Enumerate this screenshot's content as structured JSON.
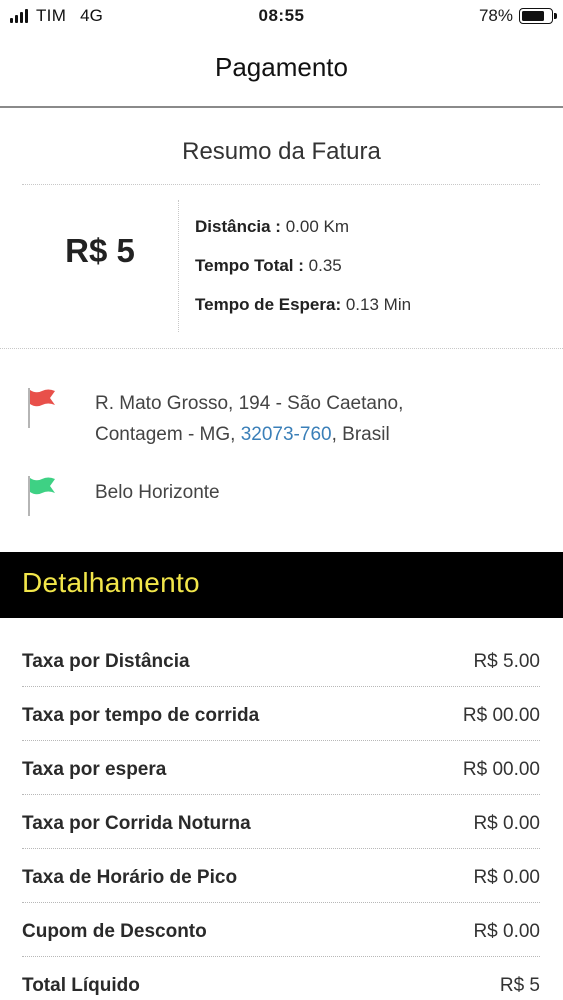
{
  "status_bar": {
    "carrier": "TIM",
    "network": "4G",
    "time": "08:55",
    "battery": "78%",
    "battery_level": 0.78
  },
  "nav": {
    "title": "Pagamento"
  },
  "summary": {
    "title": "Resumo da Fatura",
    "amount": "R$ 5",
    "metrics": [
      {
        "label": "Distância :",
        "value": " 0.00 Km"
      },
      {
        "label": "Tempo Total :",
        "value": " 0.35"
      },
      {
        "label": "Tempo de Espera:",
        "value": " 0.13 Min"
      }
    ]
  },
  "addresses": {
    "origin": {
      "line1": "R. Mato Grosso, 194 - São Caetano,",
      "line2_prefix": "Contagem - MG, ",
      "postal_code": "32073-760",
      "line2_suffix": ", Brasil",
      "flag_color": "#e8504a"
    },
    "destination": {
      "text": "Belo Horizonte",
      "flag_color": "#3ed184"
    }
  },
  "details": {
    "title": "Detalhamento",
    "title_color": "#f2e64a",
    "rows": [
      {
        "label": "Taxa por Distância",
        "value": "R$ 5.00"
      },
      {
        "label": "Taxa por tempo de corrida",
        "value": "R$ 00.00"
      },
      {
        "label": "Taxa por espera",
        "value": "R$ 00.00"
      },
      {
        "label": "Taxa por Corrida Noturna",
        "value": "R$ 0.00"
      },
      {
        "label": "Taxa de Horário de Pico",
        "value": "R$ 0.00"
      },
      {
        "label": "Cupom de Desconto",
        "value": "R$ 0.00"
      },
      {
        "label": "Total Líquido",
        "value": "R$ 5"
      }
    ]
  }
}
